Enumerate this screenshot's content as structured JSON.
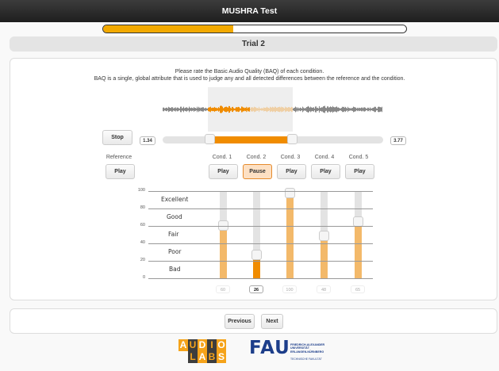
{
  "header": {
    "title": "MUSHRA Test"
  },
  "progress": {
    "fraction": 0.43
  },
  "trial": {
    "title": "Trial 2"
  },
  "instructions": {
    "line1": "Please rate the Basic Audio Quality (BAQ) of each condition.",
    "line2": "BAQ is a single, global attribute that is used to judge any and all detected differences between the reference and the condition."
  },
  "playback": {
    "stop_label": "Stop",
    "loop_start": "1.34",
    "loop_end": "3.77"
  },
  "reference": {
    "label": "Reference",
    "play_label": "Play"
  },
  "conditions": [
    {
      "name": "Cond. 1",
      "button": "Play",
      "value": "60",
      "rating": 60,
      "active": false
    },
    {
      "name": "Cond. 2",
      "button": "Pause",
      "value": "26",
      "rating": 26,
      "active": true
    },
    {
      "name": "Cond. 3",
      "button": "Play",
      "value": "100",
      "rating": 100,
      "active": false
    },
    {
      "name": "Cond. 4",
      "button": "Play",
      "value": "48",
      "rating": 48,
      "active": false
    },
    {
      "name": "Cond. 5",
      "button": "Play",
      "value": "65",
      "rating": 65,
      "active": false
    }
  ],
  "scale": {
    "ticks": [
      "100",
      "80",
      "60",
      "40",
      "20",
      "0"
    ],
    "categories": [
      "Excellent",
      "Good",
      "Fair",
      "Poor",
      "Bad"
    ]
  },
  "navigation": {
    "previous_label": "Previous",
    "next_label": "Next"
  },
  "logos": {
    "audiolabs_top": "AUDIO",
    "audiolabs_bottom": "LABS",
    "fau_short": "FAU",
    "fau_name_1": "FRIEDRICH-ALEXANDER",
    "fau_name_2": "UNIVERSITÄT",
    "fau_name_3": "ERLANGEN-NÜRNBERG",
    "fau_faculty": "TECHNISCHE FAKULTÄT"
  },
  "colors": {
    "accent": "#f08c00",
    "accent_light": "#f3b96a",
    "progress": "#f2a900",
    "audiolabs_orange": "#f5a31a",
    "audiolabs_dark": "#3d3d3d",
    "fau_blue": "#1d3e8a"
  }
}
